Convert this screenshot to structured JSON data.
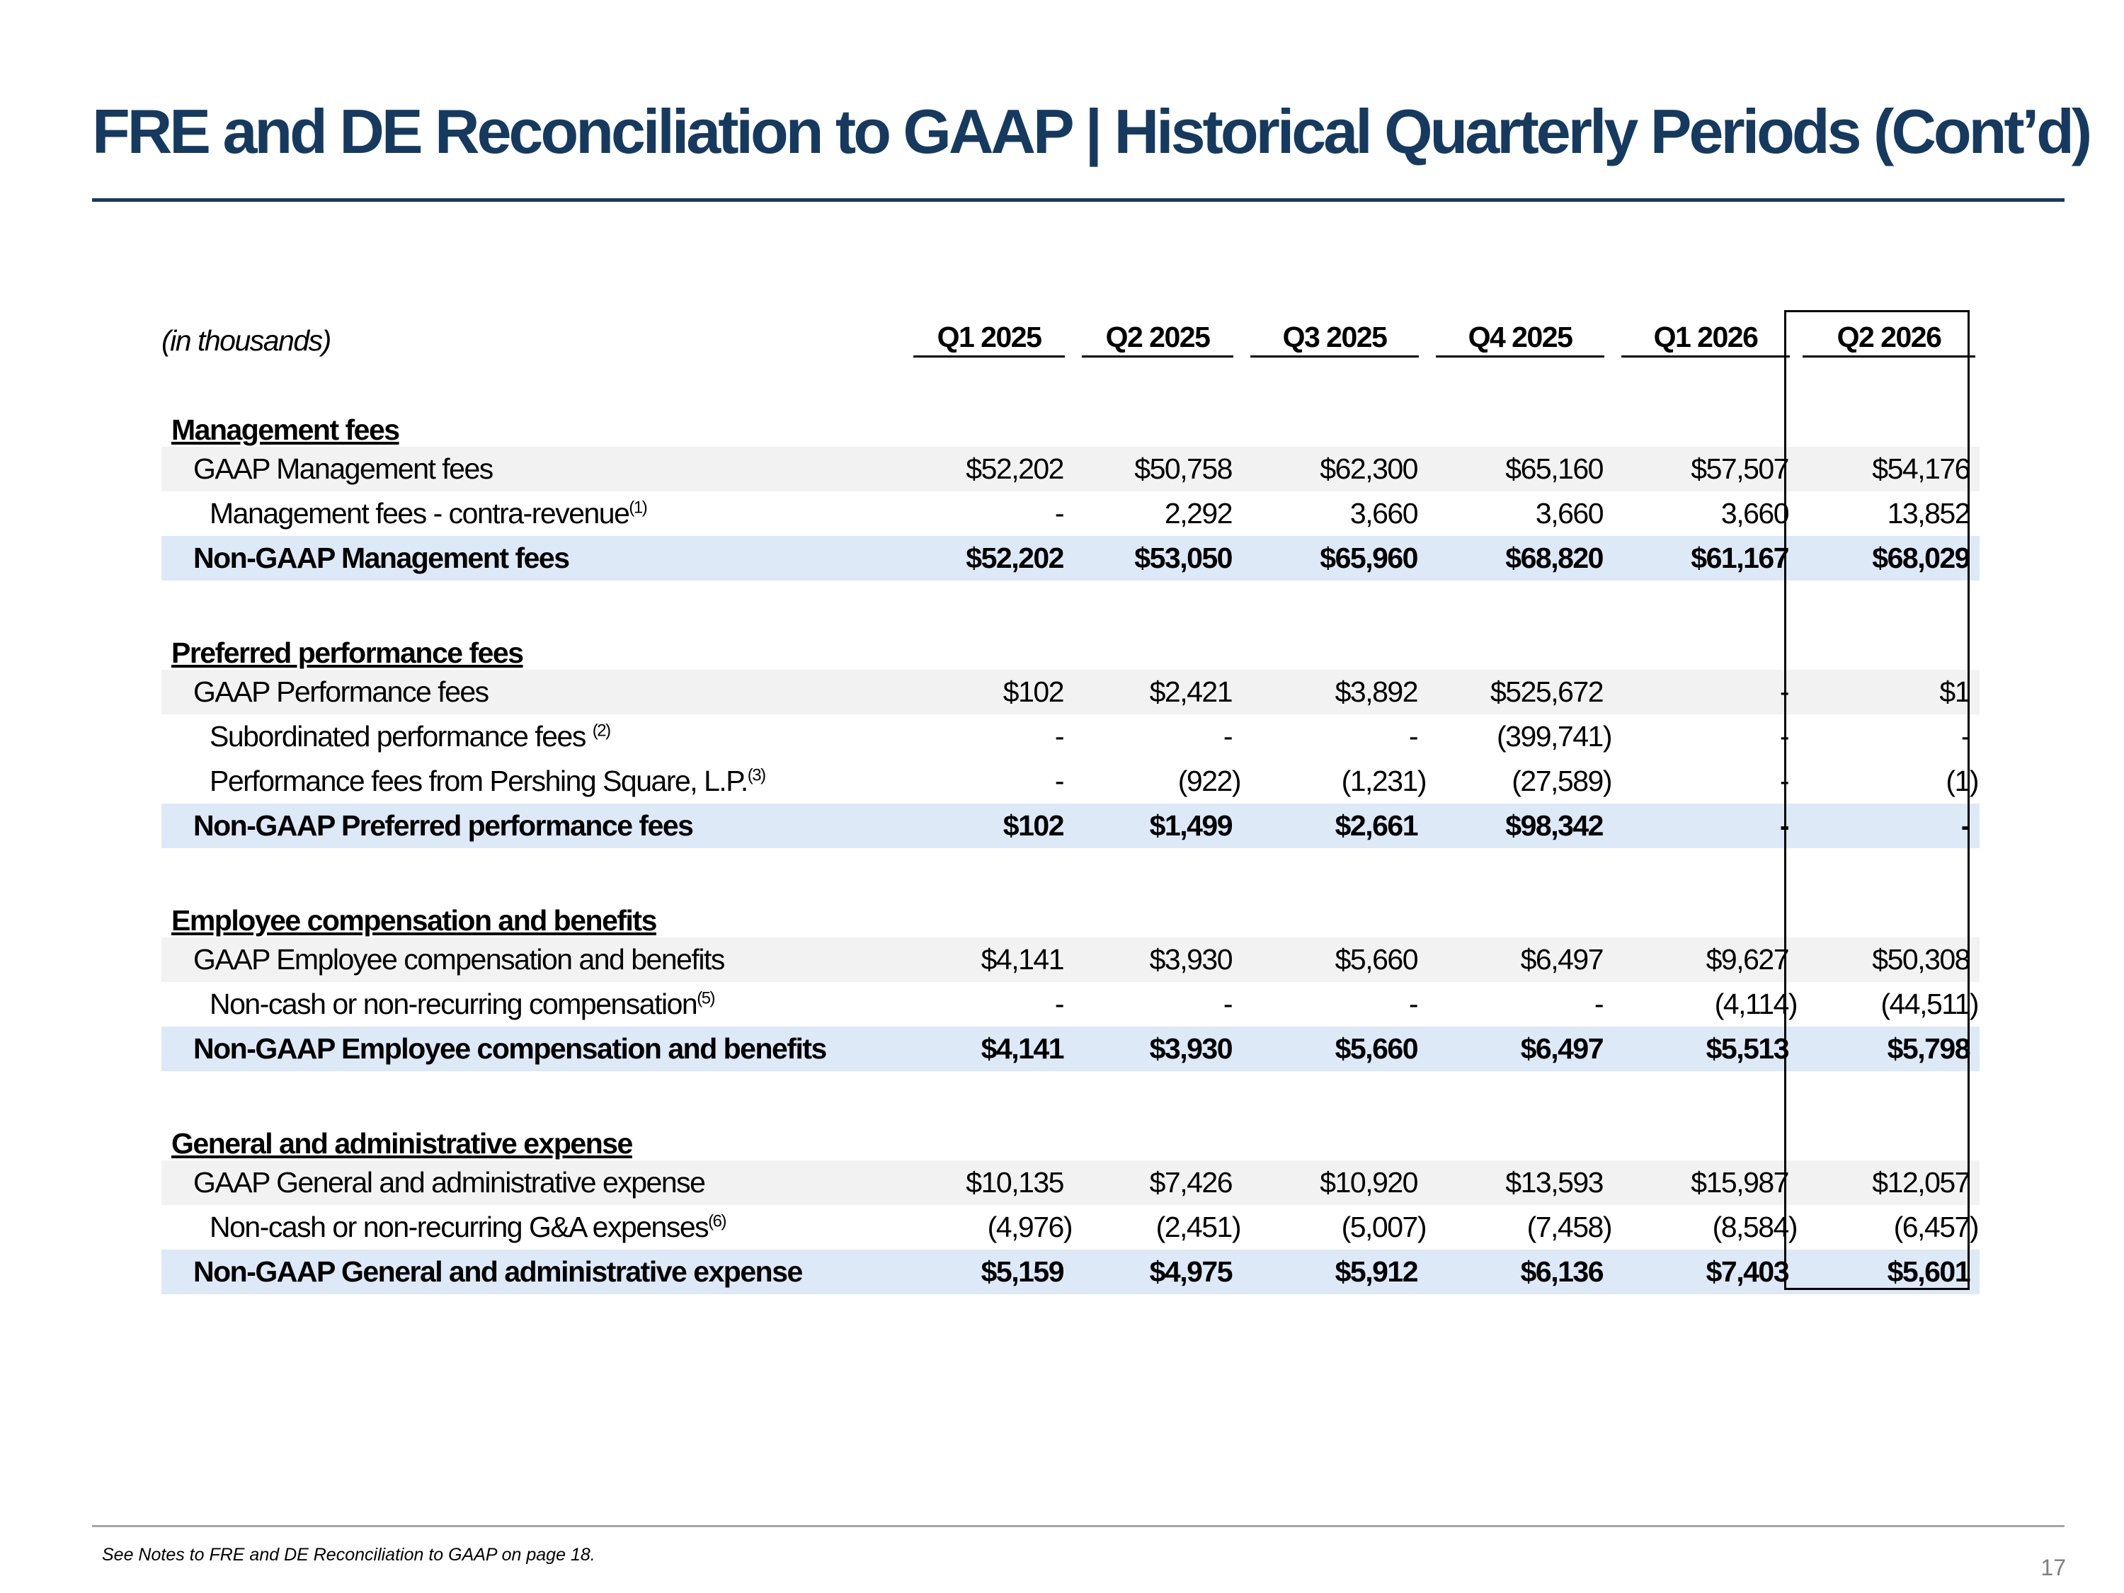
{
  "page": {
    "title": "FRE and DE Reconciliation to GAAP | Historical Quarterly Periods (Cont’d)",
    "footnote": "See Notes to FRE and DE Reconciliation to GAAP on page 18.",
    "page_number": "17"
  },
  "table": {
    "unit_label": "(in thousands)",
    "columns": [
      "Q1 2025",
      "Q2 2025",
      "Q3 2025",
      "Q4 2025",
      "Q1 2026",
      "Q2 2026"
    ],
    "sections": [
      {
        "heading": "Management fees",
        "gaap": {
          "label": "GAAP Management fees",
          "values": [
            "$52,202",
            "$50,758",
            "$62,300",
            "$65,160",
            "$57,507",
            "$54,176"
          ]
        },
        "adjustments": [
          {
            "label": "Management fees - contra-revenue",
            "note": "(1)",
            "values": [
              "-",
              "2,292",
              "3,660",
              "3,660",
              "3,660",
              "13,852"
            ]
          }
        ],
        "non_gaap": {
          "label": "Non-GAAP Management fees",
          "values": [
            "$52,202",
            "$53,050",
            "$65,960",
            "$68,820",
            "$61,167",
            "$68,029"
          ]
        }
      },
      {
        "heading": "Preferred performance fees",
        "gaap": {
          "label": "GAAP Performance fees",
          "values": [
            "$102",
            "$2,421",
            "$3,892",
            "$525,672",
            "-",
            "$1"
          ]
        },
        "adjustments": [
          {
            "label": "Subordinated performance fees ",
            "note": "(2)",
            "values": [
              "-",
              "-",
              "-",
              "(399,741)",
              "-",
              "-"
            ]
          },
          {
            "label": "Performance fees from Pershing Square, L.P.",
            "note": "(3)",
            "values": [
              "-",
              "(922)",
              "(1,231)",
              "(27,589)",
              "-",
              "(1)"
            ]
          }
        ],
        "non_gaap": {
          "label": "Non-GAAP Preferred performance fees",
          "values": [
            "$102",
            "$1,499",
            "$2,661",
            "$98,342",
            "-",
            "-"
          ]
        }
      },
      {
        "heading": "Employee compensation and benefits",
        "gaap": {
          "label": "GAAP Employee compensation and benefits",
          "values": [
            "$4,141",
            "$3,930",
            "$5,660",
            "$6,497",
            "$9,627",
            "$50,308"
          ]
        },
        "adjustments": [
          {
            "label": "Non-cash or non-recurring compensation",
            "note": "(5)",
            "values": [
              "-",
              "-",
              "-",
              "-",
              "(4,114)",
              "(44,511)"
            ]
          }
        ],
        "non_gaap": {
          "label": "Non-GAAP Employee compensation and benefits",
          "values": [
            "$4,141",
            "$3,930",
            "$5,660",
            "$6,497",
            "$5,513",
            "$5,798"
          ]
        }
      },
      {
        "heading": "General and administrative expense",
        "gaap": {
          "label": "GAAP General and administrative expense",
          "values": [
            "$10,135",
            "$7,426",
            "$10,920",
            "$13,593",
            "$15,987",
            "$12,057"
          ]
        },
        "adjustments": [
          {
            "label": "Non-cash or non-recurring G&A expenses",
            "note": "(6)",
            "values": [
              "(4,976)",
              "(2,451)",
              "(5,007)",
              "(7,458)",
              "(8,584)",
              "(6,457)"
            ]
          }
        ],
        "non_gaap": {
          "label": "Non-GAAP General and administrative expense",
          "values": [
            "$5,159",
            "$4,975",
            "$5,912",
            "$6,136",
            "$7,403",
            "$5,601"
          ]
        }
      }
    ]
  },
  "colors": {
    "title": "#163a5f",
    "gaap_row_bg": "#f2f2f2",
    "non_gaap_row_bg": "#dde9f7"
  }
}
